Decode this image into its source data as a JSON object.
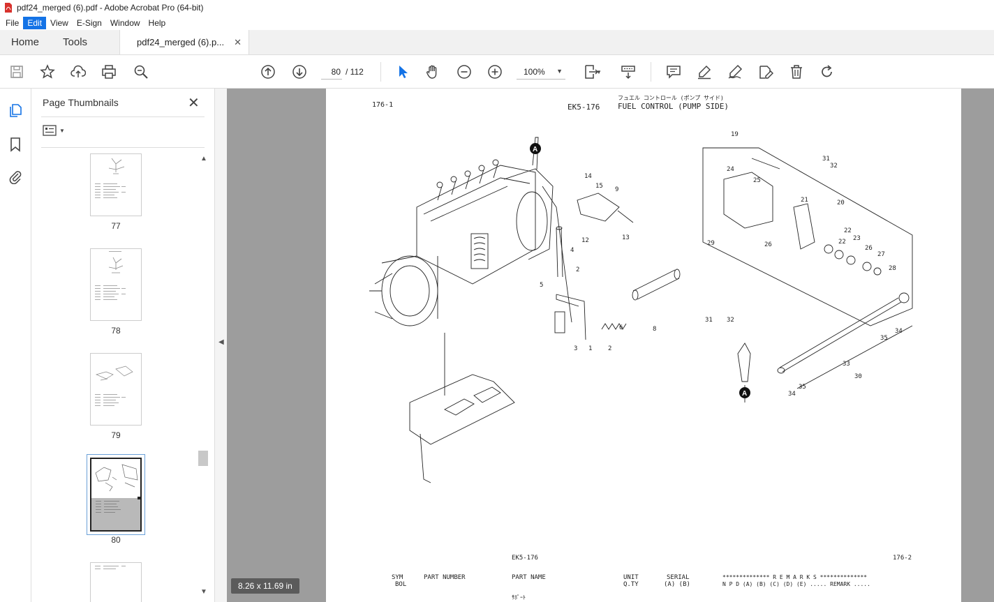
{
  "window": {
    "title": "pdf24_merged (6).pdf - Adobe Acrobat Pro (64-bit)"
  },
  "menu": {
    "items": [
      "File",
      "Edit",
      "View",
      "E-Sign",
      "Window",
      "Help"
    ],
    "active": "Edit"
  },
  "tabs": {
    "home": "Home",
    "tools": "Tools",
    "document": "pdf24_merged (6).p..."
  },
  "toolbar": {
    "current_page": "80",
    "page_of": "/  112",
    "zoom": "100%"
  },
  "sidebar": {
    "title": "Page Thumbnails",
    "thumbnails": [
      {
        "label": "77"
      },
      {
        "label": "78"
      },
      {
        "label": "79"
      },
      {
        "label": "80",
        "selected": true
      },
      {
        "label": ""
      }
    ]
  },
  "page": {
    "header_left": "176-1",
    "header_code": "EK5-176",
    "header_jp": "フュエル コントロール (ポンプ サイド)",
    "header_title": "FUEL CONTROL (PUMP SIDE)",
    "callouts": [
      "1",
      "2",
      "2",
      "3",
      "4",
      "5",
      "6",
      "8",
      "9",
      "12",
      "13",
      "14",
      "15",
      "19",
      "20",
      "21",
      "22",
      "22",
      "23",
      "24",
      "25",
      "26",
      "26",
      "27",
      "28",
      "29",
      "30",
      "31",
      "32",
      "31",
      "32",
      "33",
      "34",
      "34",
      "35",
      "35"
    ],
    "marker": "A",
    "footer_code": "EK5-176",
    "footer_page": "176-2",
    "col_sym": "SYM",
    "col_bol": "BOL",
    "col_part_number": "PART NUMBER",
    "col_part_name": "PART NAME",
    "col_unit": "UNIT",
    "col_qty": "Q.TY",
    "col_serial": "SERIAL",
    "col_serial_ab": "(A)   (B)",
    "col_remarks": "************** R E M A R K S **************",
    "col_remarks_sub": "N P D (A) (B) (C) (D) (E) ..... REMARK .....",
    "first_part": "ｻﾎﾟｰﾄ"
  },
  "status": {
    "page_size": "8.26 x 11.69 in"
  },
  "colors": {
    "accent": "#1473e6",
    "doc_bg": "#9d9d9d",
    "pdf_red": "#d8322d"
  }
}
